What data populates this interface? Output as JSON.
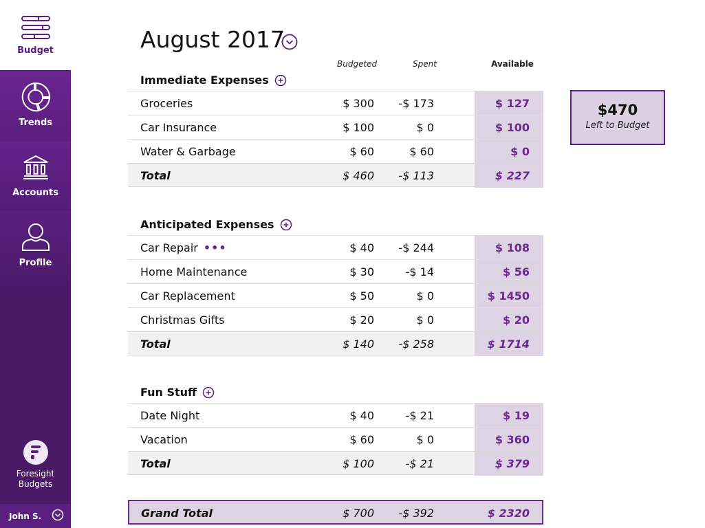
{
  "sidebar": {
    "items": [
      {
        "label": "Budget",
        "icon": "budget-icon"
      },
      {
        "label": "Trends",
        "icon": "trends-icon"
      },
      {
        "label": "Accounts",
        "icon": "bank-icon"
      },
      {
        "label": "Profile",
        "icon": "user-icon"
      }
    ],
    "brand": {
      "line1": "Foresight",
      "line2": "Budgets"
    },
    "user": {
      "name": "John S."
    }
  },
  "header": {
    "month": "August 2017",
    "columns": {
      "budgeted": "Budgeted",
      "spent": "Spent",
      "available": "Available"
    }
  },
  "summary": {
    "amount": "$470",
    "label": "Left to Budget"
  },
  "categories": [
    {
      "title": "Immediate Expenses",
      "rows": [
        {
          "name": "Groceries",
          "budgeted": "$ 300",
          "spent": "-$ 173",
          "available": "$ 127"
        },
        {
          "name": "Car Insurance",
          "budgeted": "$ 100",
          "spent": "$ 0",
          "available": "$ 100"
        },
        {
          "name": "Water & Garbage",
          "budgeted": "$ 60",
          "spent": "$ 60",
          "available": "$ 0"
        }
      ],
      "total": {
        "name": "Total",
        "budgeted": "$ 460",
        "spent": "-$ 113",
        "available": "$ 227"
      }
    },
    {
      "title": "Anticipated Expenses",
      "rows": [
        {
          "name": "Car Repair",
          "budgeted": "$ 40",
          "spent": "-$ 244",
          "available": "$ 108"
        },
        {
          "name": "Home Maintenance",
          "budgeted": "$ 30",
          "spent": "-$ 14",
          "available": "$ 56"
        },
        {
          "name": "Car Replacement",
          "budgeted": "$ 50",
          "spent": "$ 0",
          "available": "$ 1450"
        },
        {
          "name": "Christmas Gifts",
          "budgeted": "$ 20",
          "spent": "$ 0",
          "available": "$ 20"
        }
      ],
      "total": {
        "name": "Total",
        "budgeted": "$ 140",
        "spent": "-$ 258",
        "available": "$ 1714"
      }
    },
    {
      "title": "Fun Stuff",
      "rows": [
        {
          "name": "Date Night",
          "budgeted": "$ 40",
          "spent": "-$ 21",
          "available": "$ 19"
        },
        {
          "name": "Vacation",
          "budgeted": "$ 60",
          "spent": "$ 0",
          "available": "$ 360"
        }
      ],
      "total": {
        "name": "Total",
        "budgeted": "$ 100",
        "spent": "-$ 21",
        "available": "$ 379"
      }
    }
  ],
  "grand_total": {
    "name": "Grand Total",
    "budgeted": "$ 700",
    "spent": "-$ 392",
    "available": "$ 2320"
  },
  "colors": {
    "brand": "#5e1f82",
    "sidebar": "#4a1a66",
    "available_bg": "#ddd3e3",
    "accent_text": "#6a2a8e"
  }
}
